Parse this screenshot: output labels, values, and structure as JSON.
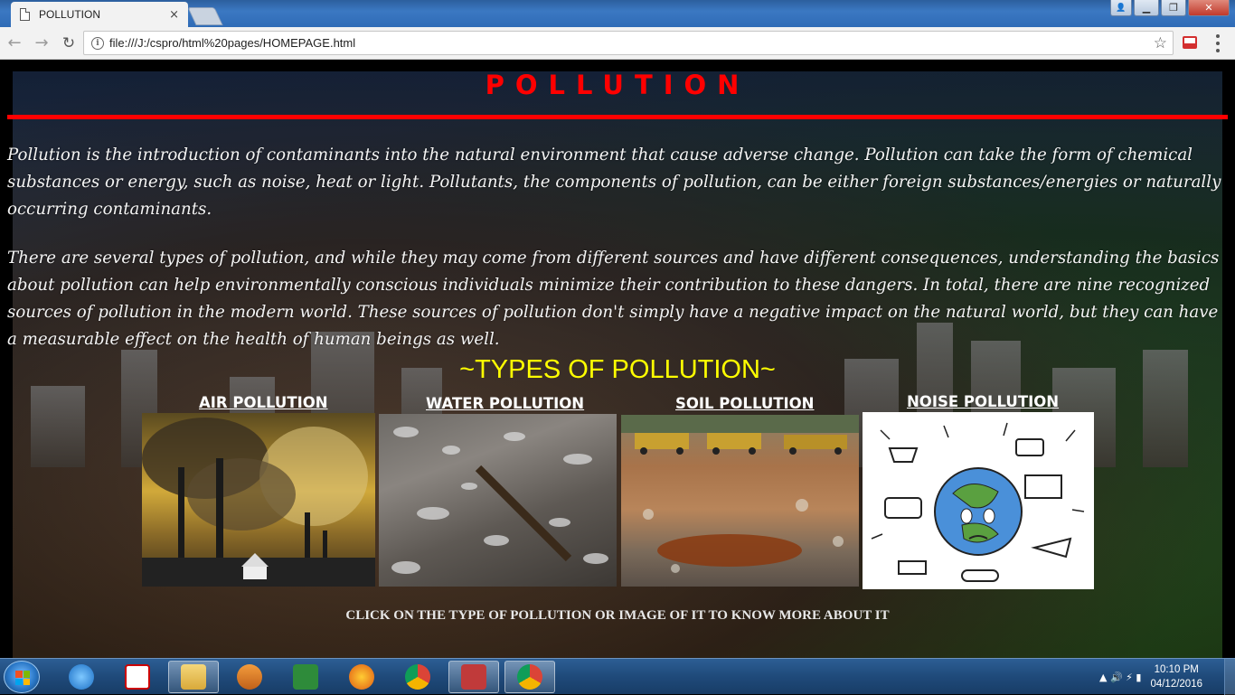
{
  "browser": {
    "tab_title": "POLLUTION",
    "tab_close": "×",
    "url": "file:///J:/cspro/html%20pages/HOMEPAGE.html",
    "back_glyph": "←",
    "forward_glyph": "→",
    "reload_glyph": "↻",
    "info_glyph": "i",
    "star_glyph": "☆",
    "window_buttons": {
      "minimize": "▁",
      "maximize": "❐",
      "close": "✕",
      "user": "👤"
    }
  },
  "page": {
    "title": "POLLUTION",
    "paragraph_1": "Pollution is the introduction of contaminants into the natural environment that cause adverse change. Pollution can take the form of chemical substances or energy, such as noise, heat or light. Pollutants, the components of pollution, can be either foreign substances/energies or naturally occurring contaminants.",
    "paragraph_2": "There are several types of pollution, and while they may come from different sources and have different consequences, understanding the basics about pollution can help environmentally conscious individuals minimize their contribution to these dangers. In total, there are nine recognized sources of pollution in the modern world. These sources of pollution don't simply have a negative impact on the natural world, but they can have a measurable effect on the health of human beings as well.",
    "types_heading": "~TYPES OF POLLUTION~",
    "types": [
      {
        "label": "AIR POLLUTION "
      },
      {
        "label": "WATER POLLUTION "
      },
      {
        "label": "SOIL POLLUTION "
      },
      {
        "label": "NOISE POLLUTION "
      }
    ],
    "footer_note": "CLICK ON THE TYPE OF POLLUTION OR IMAGE OF IT TO KNOW MORE ABOUT IT",
    "colors": {
      "title": "#ff0000",
      "heading": "#ffff00",
      "text": "#f4f4f4"
    }
  },
  "taskbar": {
    "time": "10:10 PM",
    "date": "04/12/2016",
    "tray_glyphs": "▲  🔊  ⚡  ▮",
    "apps": [
      "internet-explorer-icon",
      "iball-icon",
      "file-explorer-icon",
      "media-player-icon",
      "excel-icon",
      "firefox-icon",
      "chrome-icon",
      "app-icon",
      "chrome-active-icon"
    ]
  }
}
